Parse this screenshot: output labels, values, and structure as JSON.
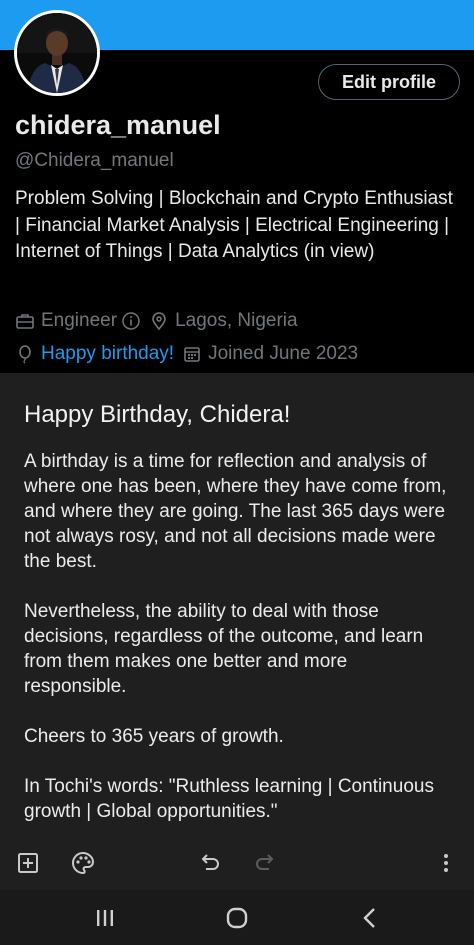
{
  "profile": {
    "display_name": "chidera_manuel",
    "handle": "@Chidera_manuel",
    "edit_profile_label": "Edit profile",
    "bio": "Problem Solving | Blockchain and Crypto Enthusiast | Financial Market Analysis | Electrical Engineering | Internet of Things | Data Analytics (in view)",
    "profession": "Engineer",
    "location": "Lagos, Nigeria",
    "birthday_link": "Happy birthday!",
    "joined": "Joined June 2023",
    "banner_color": "#1d9bf0"
  },
  "note": {
    "title": "Happy Birthday, Chidera!",
    "paragraphs": [
      "A birthday is a time for reflection and analysis of where one has been, where they have come from, and where they are going. The last 365 days were not always rosy, and not all decisions made were the best.",
      "Nevertheless, the ability to deal with those decisions, regardless of the outcome, and learn from them makes one better and more responsible.",
      "Cheers to 365 years of growth.",
      "In Tochi's words: \"Ruthless learning | Continuous growth | Global opportunities.\""
    ]
  },
  "toolbar": {
    "icons": [
      "add-box-icon",
      "palette-icon",
      "undo-icon",
      "redo-icon",
      "more-vert-icon"
    ]
  },
  "navbar": {
    "icons": [
      "recents-icon",
      "home-icon",
      "back-icon"
    ]
  }
}
